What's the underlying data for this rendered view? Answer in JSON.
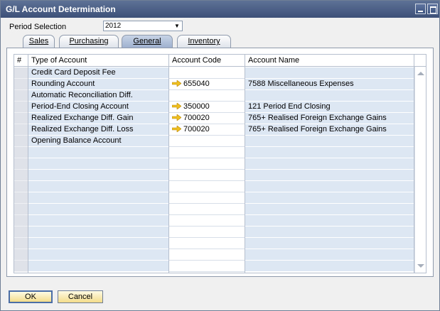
{
  "window": {
    "title": "G/L Account Determination"
  },
  "period": {
    "label": "Period Selection",
    "value": "2012"
  },
  "tabs": [
    {
      "label": "Sales",
      "active": false
    },
    {
      "label": "Purchasing",
      "active": false
    },
    {
      "label": "General",
      "active": true
    },
    {
      "label": "Inventory",
      "active": false
    }
  ],
  "table": {
    "headers": {
      "num": "#",
      "type": "Type of Account",
      "code": "Account Code",
      "name": "Account Name"
    },
    "rows": [
      {
        "type": "Credit Card Deposit Fee",
        "code": "",
        "name": ""
      },
      {
        "type": "Rounding Account",
        "code": "655040",
        "name": "7588 Miscellaneous Expenses"
      },
      {
        "type": "Automatic Reconciliation Diff.",
        "code": "",
        "name": ""
      },
      {
        "type": "Period-End Closing Account",
        "code": "350000",
        "name": "121 Period End Closing"
      },
      {
        "type": "Realized Exchange Diff. Gain",
        "code": "700020",
        "name": "765+ Realised Foreign Exchange Gains"
      },
      {
        "type": "Realized Exchange Diff. Loss",
        "code": "700020",
        "name": "765+ Realised Foreign Exchange Gains"
      },
      {
        "type": "Opening Balance Account",
        "code": "",
        "name": ""
      }
    ],
    "empty_rows": 11
  },
  "buttons": {
    "ok": "OK",
    "cancel": "Cancel"
  },
  "colors": {
    "title_bar": "#3d5078",
    "row_fill": "#dde6f3",
    "link_arrow": "#f0c020",
    "button_fill": "#f3dc8a"
  },
  "icons": {
    "link": "orange-link-arrow-icon"
  }
}
